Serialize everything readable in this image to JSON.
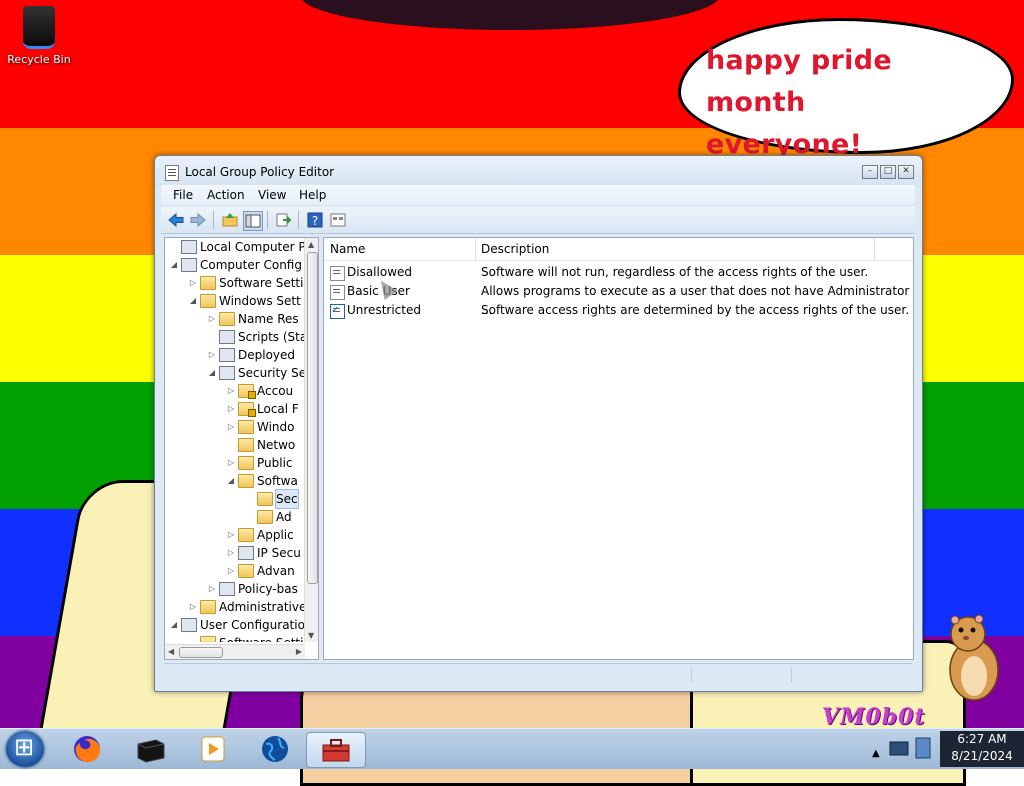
{
  "desktop": {
    "icons": [
      {
        "label": "Recycle Bin",
        "icon": "recycle-bin-icon"
      }
    ],
    "speech_bubble": {
      "line1": "happy pride month",
      "line2": "everyone!"
    },
    "watermark": "VM0b0t",
    "stripe_colors": [
      "#ff0000",
      "#ff8800",
      "#ffff00",
      "#00a000",
      "#1030ff",
      "#8000a0"
    ]
  },
  "window": {
    "title": "Local Group Policy Editor",
    "menu": [
      "File",
      "Action",
      "View",
      "Help"
    ],
    "tree": [
      {
        "label": "Local Computer Polic",
        "depth": 0,
        "arrow": "",
        "icon": "computer-policy-icon"
      },
      {
        "label": "Computer Config",
        "depth": 0,
        "arrow": "expanded",
        "icon": "computer-icon"
      },
      {
        "label": "Software Setti",
        "depth": 1,
        "arrow": "collapsed",
        "icon": "folder-icon"
      },
      {
        "label": "Windows Sett",
        "depth": 1,
        "arrow": "expanded",
        "icon": "folder-icon"
      },
      {
        "label": "Name Res",
        "depth": 2,
        "arrow": "collapsed",
        "icon": "folder-icon"
      },
      {
        "label": "Scripts (Sta",
        "depth": 2,
        "arrow": "",
        "icon": "script-icon"
      },
      {
        "label": "Deployed",
        "depth": 2,
        "arrow": "collapsed",
        "icon": "printer-icon"
      },
      {
        "label": "Security Se",
        "depth": 2,
        "arrow": "expanded",
        "icon": "security-icon"
      },
      {
        "label": "Accou",
        "depth": 3,
        "arrow": "collapsed",
        "icon": "locked-folder-icon"
      },
      {
        "label": "Local F",
        "depth": 3,
        "arrow": "collapsed",
        "icon": "locked-folder-icon"
      },
      {
        "label": "Windo",
        "depth": 3,
        "arrow": "collapsed",
        "icon": "folder-icon"
      },
      {
        "label": "Netwo",
        "depth": 3,
        "arrow": "",
        "icon": "folder-icon"
      },
      {
        "label": "Public",
        "depth": 3,
        "arrow": "collapsed",
        "icon": "folder-icon"
      },
      {
        "label": "Softwa",
        "depth": 3,
        "arrow": "expanded",
        "icon": "folder-icon"
      },
      {
        "label": "Sec",
        "depth": 4,
        "arrow": "",
        "icon": "folder-icon",
        "selected": true
      },
      {
        "label": "Ad",
        "depth": 4,
        "arrow": "",
        "icon": "folder-icon"
      },
      {
        "label": "Applic",
        "depth": 3,
        "arrow": "collapsed",
        "icon": "folder-icon"
      },
      {
        "label": "IP Secu",
        "depth": 3,
        "arrow": "collapsed",
        "icon": "ipsec-icon"
      },
      {
        "label": "Advan",
        "depth": 3,
        "arrow": "collapsed",
        "icon": "folder-icon"
      },
      {
        "label": "Policy-bas",
        "depth": 2,
        "arrow": "collapsed",
        "icon": "chart-icon"
      },
      {
        "label": "Administrative",
        "depth": 1,
        "arrow": "collapsed",
        "icon": "folder-icon"
      },
      {
        "label": "User Configuratio",
        "depth": 0,
        "arrow": "expanded",
        "icon": "user-icon"
      },
      {
        "label": "Software Setti",
        "depth": 1,
        "arrow": "",
        "icon": "folder-icon"
      }
    ],
    "columns": {
      "name": "Name",
      "description": "Description"
    },
    "rows": [
      {
        "name": "Disallowed",
        "description": "Software will not run, regardless of the access rights of the user.",
        "checked": false
      },
      {
        "name": "Basic User",
        "description": "Allows programs to execute as a user that does not have Administrator ...",
        "checked": false
      },
      {
        "name": "Unrestricted",
        "description": "Software access rights are determined by the access rights of the user.",
        "checked": true
      }
    ]
  },
  "taskbar": {
    "apps": [
      "firefox-icon",
      "terminal-icon",
      "media-player-icon",
      "globe-icon",
      "toolbox-icon"
    ],
    "active_app": "toolbox-icon",
    "clock": {
      "time": "6:27 AM",
      "date": "8/21/2024"
    }
  }
}
